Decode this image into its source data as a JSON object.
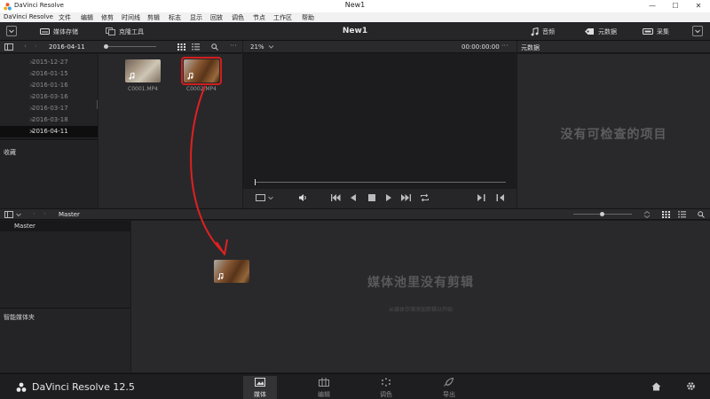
{
  "window": {
    "app_name": "DaVinci Resolve",
    "title": "New1",
    "controls": [
      "—",
      "☐",
      "✕"
    ]
  },
  "menu": [
    "文件",
    "编辑",
    "修剪",
    "时间线",
    "剪辑",
    "标志",
    "显示",
    "回放",
    "调色",
    "节点",
    "工作区",
    "帮助"
  ],
  "toolbar": {
    "media_storage": "媒体存储",
    "clone_tool": "克隆工具",
    "project_title": "New1",
    "audio": "音频",
    "metadata": "元数据",
    "capture": "采集"
  },
  "storage": {
    "current_folder": "2016-04-11",
    "dates": [
      "2015-12-27",
      "2016-01-15",
      "2016-01-16",
      "2016-03-16",
      "2016-03-17",
      "2016-03-18",
      "2016-04-11"
    ],
    "selected_index": 6,
    "favorites_label": "收藏"
  },
  "media_browser": {
    "clips": [
      {
        "name": "C0001.MP4",
        "selected": false
      },
      {
        "name": "C0002.MP4",
        "selected": true
      }
    ]
  },
  "viewer": {
    "zoom": "21%",
    "timecode": "00:00:00:00"
  },
  "metadata_panel": {
    "header": "元数据",
    "empty_message": "没有可检查的项目"
  },
  "media_pool": {
    "bin_header": "Master",
    "master_bin": "Master",
    "smart_bins_label": "智能媒体夹",
    "empty_title": "媒体池里没有剪辑",
    "empty_hint": "从媒体存储添加剪辑以开始"
  },
  "pagebar": {
    "brand": "DaVinci Resolve 12.5",
    "tabs": [
      "媒体",
      "编辑",
      "调色",
      "导出"
    ],
    "active_tab": 0
  },
  "colors": {
    "selection_highlight": "#d21e1e",
    "annotation_arrow": "#e02020"
  }
}
